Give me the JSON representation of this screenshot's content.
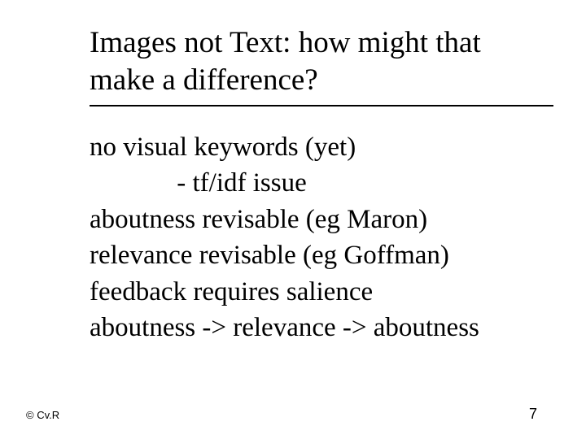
{
  "slide": {
    "title": "Images not Text: how might that make a difference?",
    "lines": [
      "no visual keywords (yet)",
      "             - tf/idf issue",
      "aboutness revisable (eg Maron)",
      "relevance revisable (eg Goffman)",
      "feedback requires salience",
      "aboutness -> relevance -> aboutness"
    ],
    "footer": {
      "copyright": "© Cv.R",
      "page": "7"
    }
  }
}
